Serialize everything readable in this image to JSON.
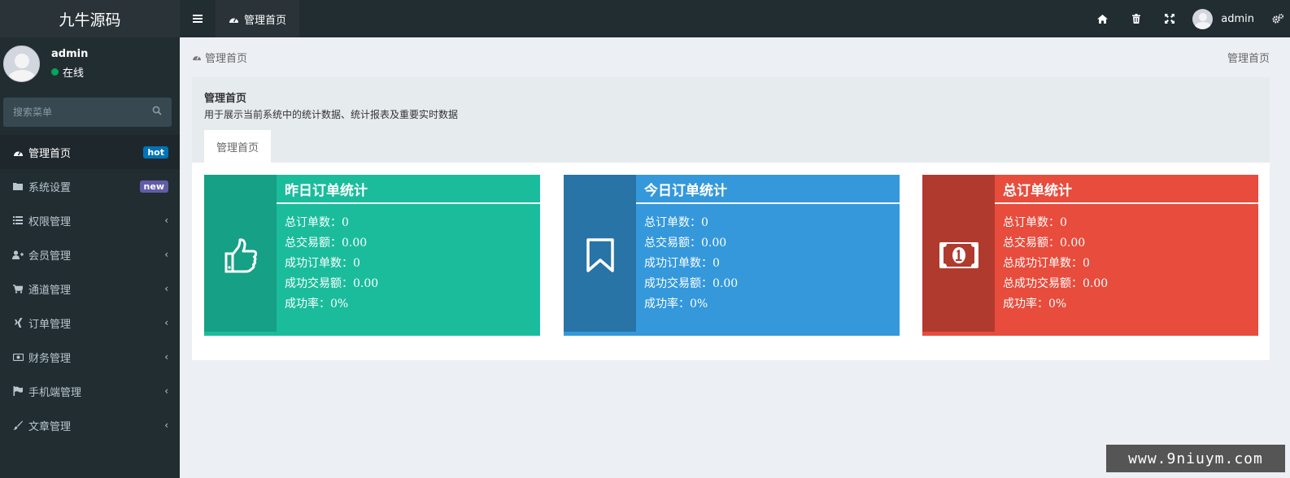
{
  "app": {
    "logo": "九牛源码"
  },
  "user": {
    "name": "admin",
    "status": "在线"
  },
  "search": {
    "placeholder": "搜索菜单"
  },
  "menu": [
    {
      "label": "管理首页",
      "icon": "dashboard-icon",
      "badge": "hot",
      "active": true
    },
    {
      "label": "系统设置",
      "icon": "folder-icon",
      "badge": "new"
    },
    {
      "label": "权限管理",
      "icon": "list-icon",
      "chevron": "‹"
    },
    {
      "label": "会员管理",
      "icon": "user-plus-icon",
      "chevron": "‹"
    },
    {
      "label": "通道管理",
      "icon": "cart-icon",
      "chevron": "‹"
    },
    {
      "label": "订单管理",
      "icon": "xing-icon",
      "chevron": "‹"
    },
    {
      "label": "财务管理",
      "icon": "money-icon",
      "chevron": "‹"
    },
    {
      "label": "手机端管理",
      "icon": "flag-icon",
      "chevron": "‹"
    },
    {
      "label": "文章管理",
      "icon": "brush-icon",
      "chevron": "‹"
    }
  ],
  "topnav": {
    "tab": "管理首页",
    "user": "admin"
  },
  "content": {
    "breadcrumb": "管理首页",
    "breadcrumb_right": "管理首页",
    "box_title": "管理首页",
    "box_desc": "用于展示当前系统中的统计数据、统计报表及重要实时数据",
    "box_tab": "管理首页"
  },
  "cards": [
    {
      "title": "昨日订单统计",
      "icon": "thumbs-up-icon",
      "color_main": "#1abc9c",
      "color_dark": "#16a085",
      "lines": [
        "总订单数：0",
        "总交易额：0.00",
        "成功订单数：0",
        "成功交易额：0.00",
        "成功率：0%"
      ]
    },
    {
      "title": "今日订单统计",
      "icon": "bookmark-icon",
      "color_main": "#3498db",
      "color_dark": "#2874a6",
      "lines": [
        "总订单数：0",
        "总交易额：0.00",
        "成功订单数：0",
        "成功交易额：0.00",
        "成功率：0%"
      ]
    },
    {
      "title": "总订单统计",
      "icon": "money-bill-icon",
      "color_main": "#e74c3c",
      "color_dark": "#b03a2e",
      "lines": [
        "总订单数：0",
        "总交易额：0.00",
        "总成功订单数：0",
        "总成功交易额：0.00",
        "成功率：0%"
      ]
    }
  ],
  "watermark": "www.9niuym.com"
}
